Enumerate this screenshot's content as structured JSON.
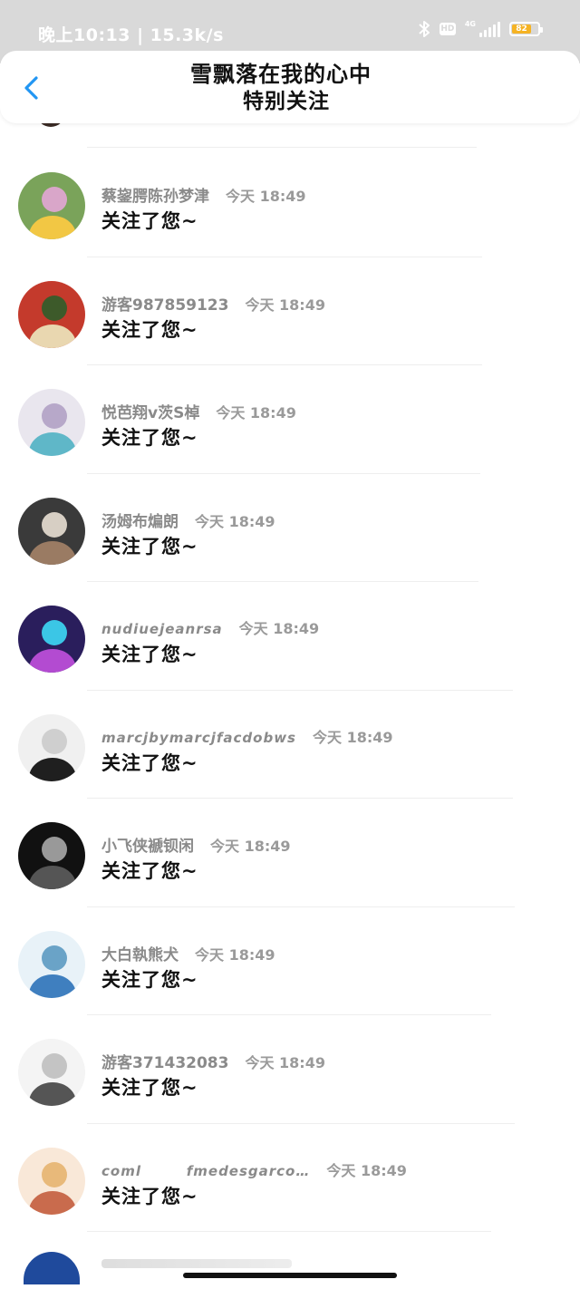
{
  "status_bar": {
    "time_speed": "晚上10:13 | 15.3k/s",
    "hd_label": "HD",
    "network_label": "4G",
    "battery_level": "82"
  },
  "header": {
    "title": "雪飘落在我的心中",
    "subtitle": "特别关注"
  },
  "colors": {
    "back_arrow": "#2196f3",
    "battery_fill": "#f5b324",
    "status_bar_bg": "#d9d9d9"
  },
  "followers": [
    {
      "name": "蔡鋆腭陈孙梦津",
      "time": "今天 18:49",
      "action": "关注了您~"
    },
    {
      "name": "游客987859123",
      "time": "今天 18:49",
      "action": "关注了您~"
    },
    {
      "name": "悦芭翔v茨S棹",
      "time": "今天 18:49",
      "action": "关注了您~"
    },
    {
      "name": "汤姆布煸朗",
      "time": "今天 18:49",
      "action": "关注了您~"
    },
    {
      "name": "nudiuejeanrsa",
      "time": "今天 18:49",
      "action": "关注了您~"
    },
    {
      "name": "marcjbymarcjfacdobws",
      "time": "今天 18:49",
      "action": "关注了您~"
    },
    {
      "name": "小飞侠褫钡闲",
      "time": "今天 18:49",
      "action": "关注了您~"
    },
    {
      "name": "大白執熊犬",
      "time": "今天 18:49",
      "action": "关注了您~"
    },
    {
      "name": "游客371432083",
      "time": "今天 18:49",
      "action": "关注了您~"
    },
    {
      "name": "coml        fmedesgarco…",
      "time": "今天 18:49",
      "action": "关注了您~"
    }
  ]
}
